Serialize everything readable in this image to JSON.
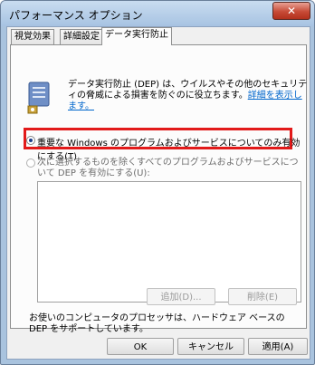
{
  "window": {
    "title": "パフォーマンス オプション",
    "close_label": "✕"
  },
  "tabs": [
    {
      "label": "視覚効果"
    },
    {
      "label": "詳細設定"
    },
    {
      "label": "データ実行防止"
    }
  ],
  "dep": {
    "desc_text": "データ実行防止 (DEP) は、ウイルスやその他のセキュリティの脅威による損害を防ぐのに役立ちます。",
    "desc_link": "詳細を表示します。",
    "option1_label": "重要な Windows のプログラムおよびサービスについてのみ有効にする(T)",
    "option2_label": "次に選択するものを除くすべてのプログラムおよびサービスについて DEP を有効にする(U):",
    "add_button": "追加(D)...",
    "delete_button": "削除(E)",
    "hardware_note": "お使いのコンピュータのプロセッサは、ハードウェア ベースの DEP をサポートしています。"
  },
  "footer": {
    "ok": "OK",
    "cancel": "キャンセル",
    "apply": "適用(A)"
  },
  "colors": {
    "highlight": "#e21a1a",
    "link": "#0066cc"
  },
  "icons": {
    "shield": "shield-icon"
  }
}
